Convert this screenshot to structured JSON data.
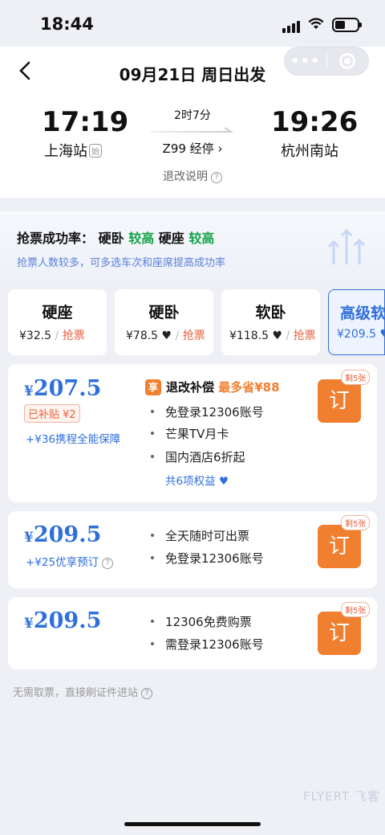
{
  "status_bar": {
    "time": "18:44"
  },
  "header": {
    "title": "09月21日 周日出发",
    "capsule_dots": "•••"
  },
  "trip": {
    "depart_time": "17:19",
    "depart_station": "上海站",
    "depart_tag": "始",
    "duration": "2时7分",
    "train_no": "Z99 经停 ›",
    "arrive_time": "19:26",
    "arrive_station": "杭州南站",
    "refund_info": "退改说明"
  },
  "success_rate": {
    "label": "抢票成功率：",
    "seat1": "硬卧",
    "level1": "较高",
    "seat2": "硬座",
    "level2": "较高",
    "hint": "抢票人数较多，可多选车次和座席提高成功率"
  },
  "seats": [
    {
      "name": "硬座",
      "price": "¥32.5",
      "action": "抢票"
    },
    {
      "name": "硬卧",
      "price": "¥78.5",
      "action": "抢票"
    },
    {
      "name": "软卧",
      "price": "¥118.5",
      "action": "抢票"
    },
    {
      "name": "高级软卧",
      "price": "¥209.5"
    }
  ],
  "offers": [
    {
      "price_symbol": "¥",
      "price": "207.5",
      "subsidy": "已补贴 ¥2",
      "addon": "+¥36携程全能保障",
      "badge": "享",
      "benefit_title": "退改补偿",
      "benefit_save": "最多省¥88",
      "features": [
        "免登录12306账号",
        "芒果TV月卡",
        "国内酒店6折起"
      ],
      "more": "共6项权益",
      "book": "订",
      "remain": "剩5张"
    },
    {
      "price_symbol": "¥",
      "price": "209.5",
      "addon": "+¥25优享预订",
      "features": [
        "全天随时可出票",
        "免登录12306账号"
      ],
      "book": "订",
      "remain": "剩5张"
    },
    {
      "price_symbol": "¥",
      "price": "209.5",
      "features": [
        "12306免费购票",
        "需登录12306账号"
      ],
      "book": "订",
      "remain": "剩5张"
    }
  ],
  "footer_note": "无需取票，直接刷证件进站",
  "watermark": "FLYERT 飞客",
  "colors": {
    "accent_blue": "#2f6fdb",
    "orange": "#f07f2f",
    "green": "#16a34a"
  }
}
